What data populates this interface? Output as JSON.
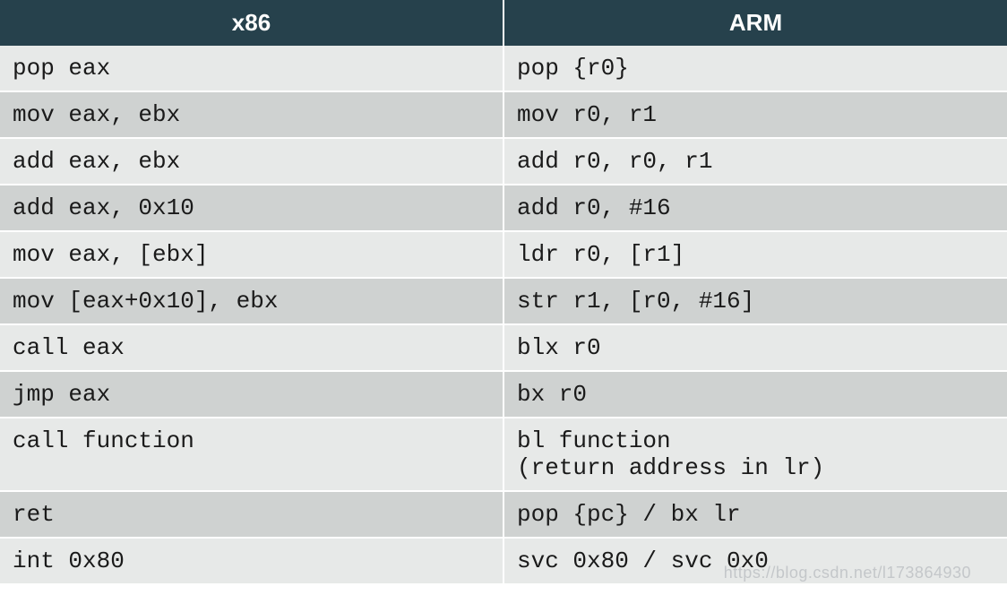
{
  "headers": {
    "col1": "x86",
    "col2": "ARM"
  },
  "rows": [
    {
      "x86": "pop eax",
      "arm": "pop {r0}"
    },
    {
      "x86": "mov eax, ebx",
      "arm": "mov r0, r1"
    },
    {
      "x86": "add eax, ebx",
      "arm": "add r0, r0, r1"
    },
    {
      "x86": "add eax, 0x10",
      "arm": "add r0, #16"
    },
    {
      "x86": "mov eax, [ebx]",
      "arm": "ldr r0, [r1]"
    },
    {
      "x86": "mov [eax+0x10], ebx",
      "arm": "str r1, [r0, #16]"
    },
    {
      "x86": "call eax",
      "arm": "blx r0"
    },
    {
      "x86": "jmp eax",
      "arm": "bx r0"
    },
    {
      "x86": "call function",
      "arm": "bl function\n(return address in lr)"
    },
    {
      "x86": "ret",
      "arm": "pop {pc} / bx lr"
    },
    {
      "x86": "int 0x80",
      "arm": "svc 0x80 / svc 0x0"
    }
  ],
  "watermark": "https://blog.csdn.net/l173864930",
  "chart_data": {
    "type": "table",
    "title": "x86 vs ARM instruction equivalents",
    "columns": [
      "x86",
      "ARM"
    ],
    "rows": [
      [
        "pop eax",
        "pop {r0}"
      ],
      [
        "mov eax, ebx",
        "mov r0, r1"
      ],
      [
        "add eax, ebx",
        "add r0, r0, r1"
      ],
      [
        "add eax, 0x10",
        "add r0, #16"
      ],
      [
        "mov eax, [ebx]",
        "ldr r0, [r1]"
      ],
      [
        "mov [eax+0x10], ebx",
        "str r1, [r0, #16]"
      ],
      [
        "call eax",
        "blx r0"
      ],
      [
        "jmp eax",
        "bx r0"
      ],
      [
        "call function",
        "bl function (return address in lr)"
      ],
      [
        "ret",
        "pop {pc} / bx lr"
      ],
      [
        "int 0x80",
        "svc 0x80 / svc 0x0"
      ]
    ]
  }
}
